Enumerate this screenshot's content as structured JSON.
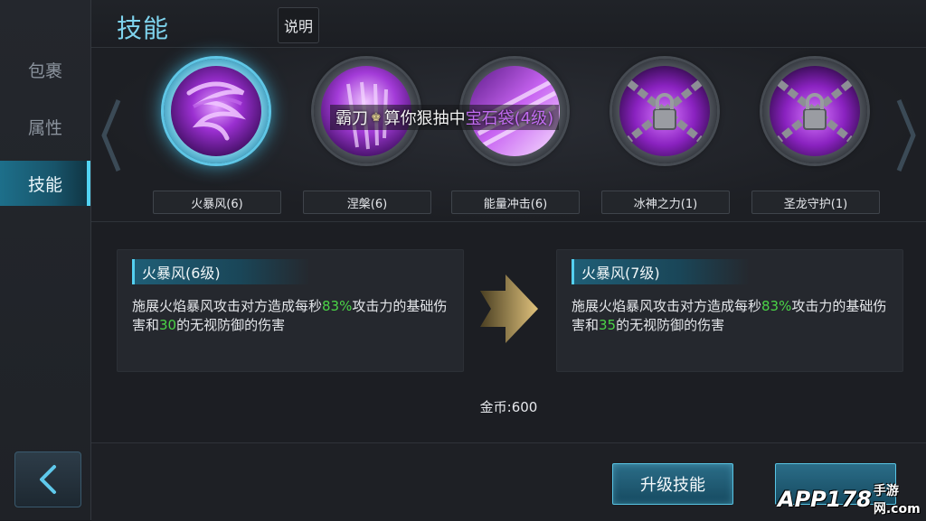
{
  "sidebar": {
    "items": [
      {
        "label": "包裹",
        "active": false
      },
      {
        "label": "属性",
        "active": false
      },
      {
        "label": "技能",
        "active": true
      }
    ]
  },
  "header": {
    "title": "技能",
    "help_label": "说明"
  },
  "skills": [
    {
      "label": "火暴风(6)",
      "selected": true,
      "locked": false
    },
    {
      "label": "涅槃(6)",
      "selected": false,
      "locked": false
    },
    {
      "label": "能量冲击(6)",
      "selected": false,
      "locked": false
    },
    {
      "label": "冰神之力(1)",
      "selected": false,
      "locked": true
    },
    {
      "label": "圣龙守护(1)",
      "selected": false,
      "locked": true
    }
  ],
  "toast": {
    "prefix": "霸刀",
    "crown": "♚",
    "middle": "算你狠抽中",
    "highlight": "宝石袋(4级)"
  },
  "current": {
    "title": "火暴风(6级)",
    "desc_a": "施展火焰暴风攻击对方造成每秒",
    "pct": "83%",
    "desc_b": "攻击力的基础伤害和",
    "flat": "30",
    "desc_c": "的无视防御的伤害"
  },
  "next": {
    "title": "火暴风(7级)",
    "desc_a": "施展火焰暴风攻击对方造成每秒",
    "pct": "83%",
    "desc_b": "攻击力的基础伤害和",
    "flat": "35",
    "desc_c": "的无视防御的伤害"
  },
  "cost": "金币:600",
  "buttons": {
    "upgrade": "升级技能"
  },
  "watermark": {
    "main": "APP178",
    "suffix": "手游网",
    "domain": ".com"
  },
  "colors": {
    "accent": "#54d0f0",
    "highlight_number": "#4bd447",
    "skill_purple": "#a23ad6"
  }
}
